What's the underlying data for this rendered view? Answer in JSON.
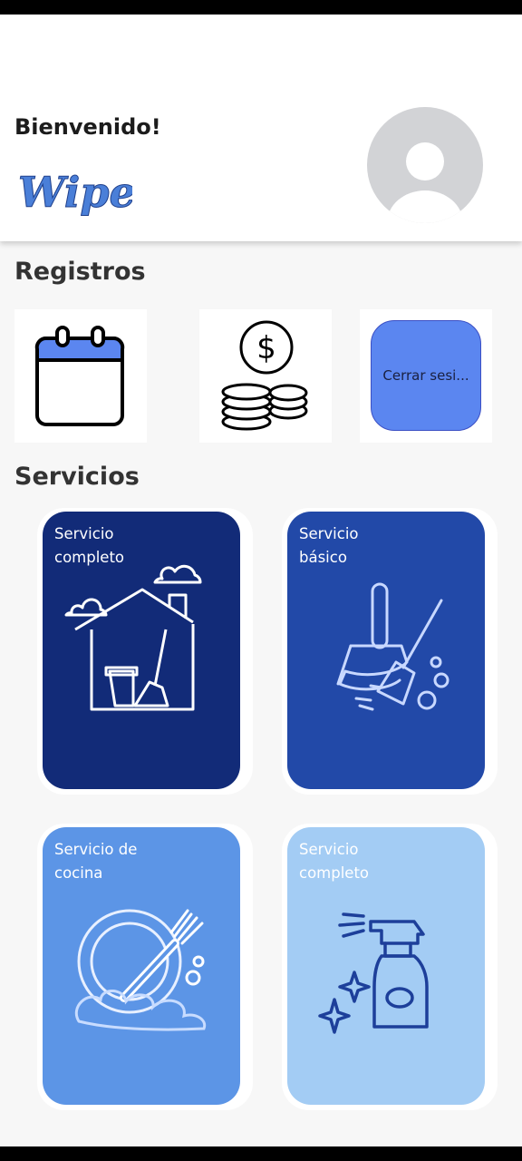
{
  "header": {
    "welcome": "Bienvenido!",
    "logo_text": "Wipe"
  },
  "registros": {
    "title": "Registros",
    "items": [
      {
        "name": "calendar-icon"
      },
      {
        "name": "coins-icon"
      },
      {
        "label": "Cerrar sesi..."
      }
    ]
  },
  "servicios": {
    "title": "Servicios",
    "items": [
      {
        "label": "Servicio\ncompleto",
        "color": "#122b78",
        "icon": "house-broom-icon"
      },
      {
        "label": "Servicio\nbásico",
        "color": "#2249a8",
        "icon": "broom-dustpan-icon"
      },
      {
        "label": "Servicio de\ncocina",
        "color": "#5c95e6",
        "icon": "plate-fork-icon"
      },
      {
        "label": "Servicio\ncompleto",
        "color": "#a3ccf4",
        "icon": "spray-bottle-icon"
      }
    ]
  },
  "colors": {
    "accent": "#5b86f0",
    "logo": "#4a7fd8"
  }
}
